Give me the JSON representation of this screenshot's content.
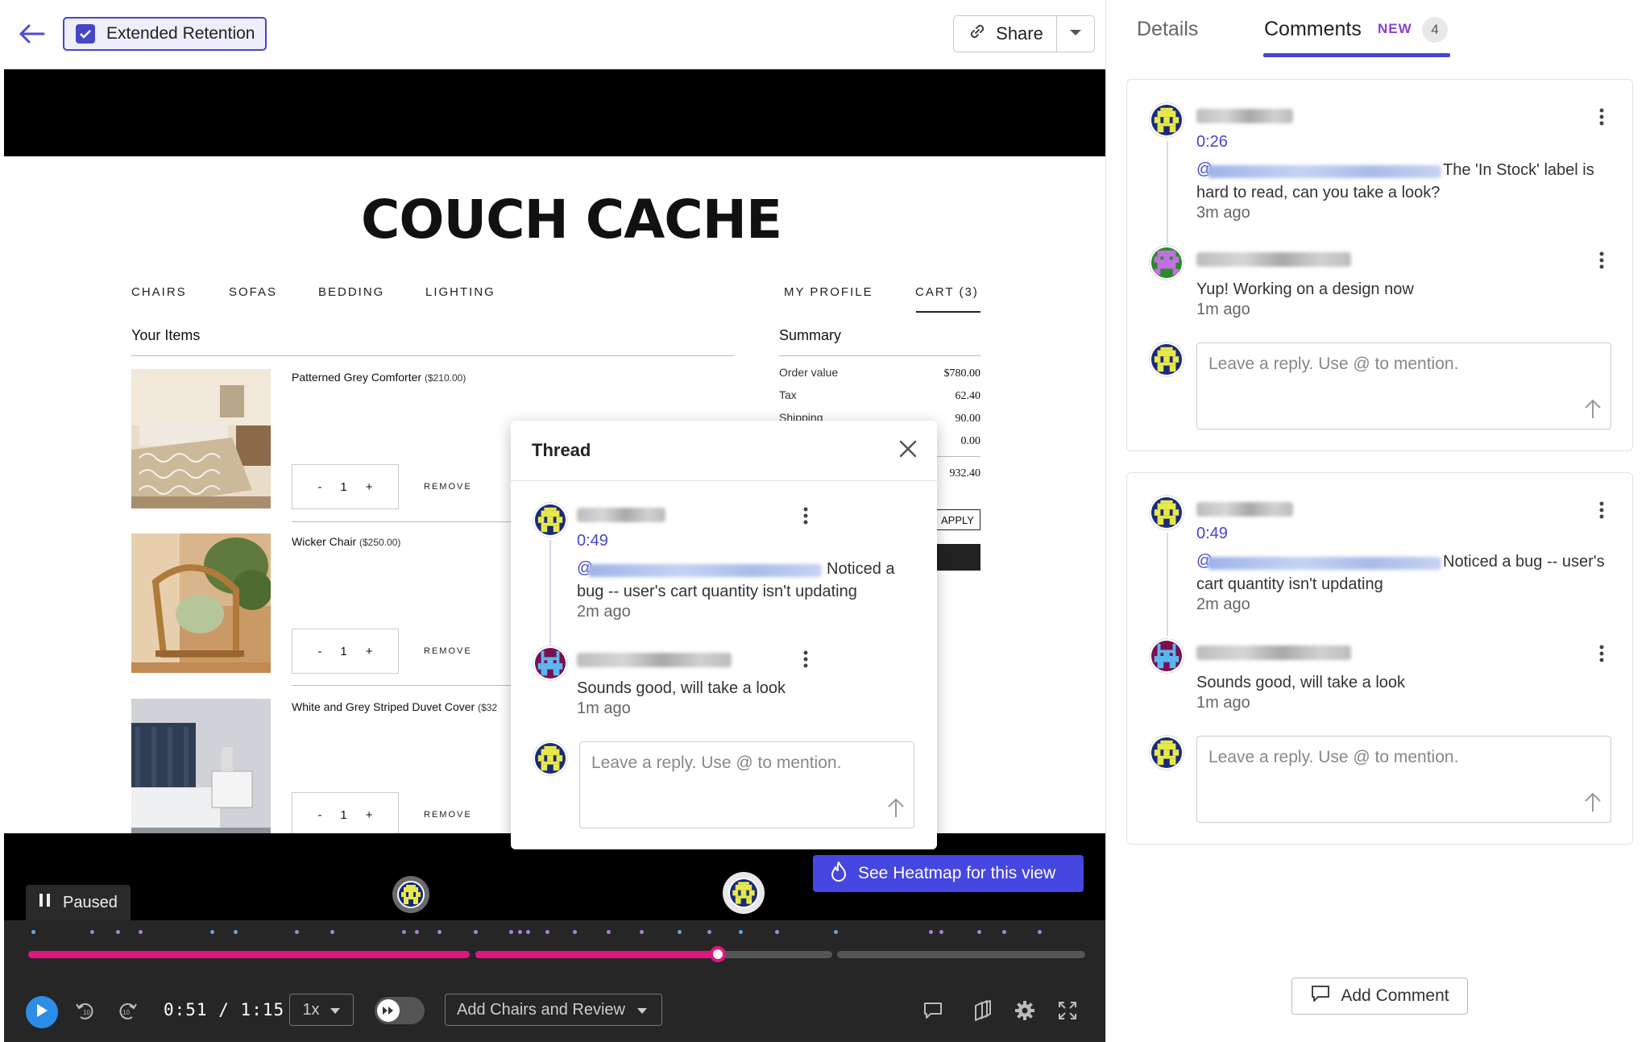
{
  "header": {
    "extended_retention_label": "Extended Retention",
    "share_label": "Share"
  },
  "tabs": {
    "details": "Details",
    "comments": "Comments",
    "new_badge": "NEW",
    "count": "4"
  },
  "site": {
    "logo": "COUCH CACHE",
    "nav": [
      "CHAIRS",
      "SOFAS",
      "BEDDING",
      "LIGHTING"
    ],
    "nav_right": [
      "MY PROFILE",
      "CART (3)"
    ],
    "items_heading": "Your Items",
    "summary_heading": "Summary",
    "products": [
      {
        "name": "Patterned Grey Comforter",
        "price": "($210.00)",
        "qty": "1"
      },
      {
        "name": "Wicker Chair",
        "price": "($250.00)",
        "qty": "1"
      },
      {
        "name": "White and Grey Striped Duvet Cover",
        "price": "($32",
        "qty": "1"
      }
    ],
    "qty_minus": "-",
    "qty_plus": "+",
    "remove_label": "REMOVE",
    "summary": [
      {
        "label": "Order value",
        "value": "$780.00"
      },
      {
        "label": "Tax",
        "value": "62.40"
      },
      {
        "label": "Shipping",
        "value": "90.00"
      },
      {
        "label": "",
        "value": "0.00"
      },
      {
        "label": "",
        "value": "932.40"
      }
    ],
    "apply_label": "APPLY"
  },
  "thread": {
    "title": "Thread",
    "comments": [
      {
        "time": "0:49",
        "mention": "@",
        "text_a": "Noticed a",
        "text_b": "bug -- user's cart quantity isn't updating",
        "ago": "2m ago"
      },
      {
        "text": "Sounds good, will take a look",
        "ago": "1m ago"
      }
    ],
    "reply_placeholder": "Leave a reply. Use @ to mention."
  },
  "panel": {
    "cards": [
      {
        "time": "0:26",
        "mention": "@",
        "text_a": "The 'In Stock' label is",
        "text_b": "hard to read, can you take a look?",
        "ago": "3m ago",
        "reply_text": "Yup! Working on a design now",
        "reply_ago": "1m ago",
        "placeholder": "Leave a reply. Use @ to mention."
      },
      {
        "time": "0:49",
        "mention": "@",
        "text_a": "Noticed a bug -- user's",
        "text_b": "cart quantity isn't updating",
        "ago": "2m ago",
        "reply_text": "Sounds good, will take a look",
        "reply_ago": "1m ago",
        "placeholder": "Leave a reply. Use @ to mention."
      }
    ],
    "add_comment_label": "Add Comment"
  },
  "player": {
    "status": "Paused",
    "current_time": "0:51",
    "duration": "1:15",
    "time_separator": "/",
    "speed": "1x",
    "page_select": "Add Chairs and Review",
    "heatmap_label": "See Heatmap for this view",
    "progress_fraction": 0.68
  },
  "colors": {
    "accent": "#4646c8",
    "progress": "#e0157f",
    "heatmap_button": "#4646e0",
    "play_button": "#2c8de8"
  },
  "icons": [
    "back-arrow-icon",
    "checkbox-checked-icon",
    "link-icon",
    "chevron-down-icon",
    "close-icon",
    "kebab-icon",
    "send-arrow-icon",
    "pause-icon",
    "play-icon",
    "rewind-10-icon",
    "forward-10-icon",
    "skip-inactivity-icon",
    "heatmap-flame-icon",
    "comment-icon",
    "layers-icon",
    "gear-icon",
    "fullscreen-icon"
  ]
}
